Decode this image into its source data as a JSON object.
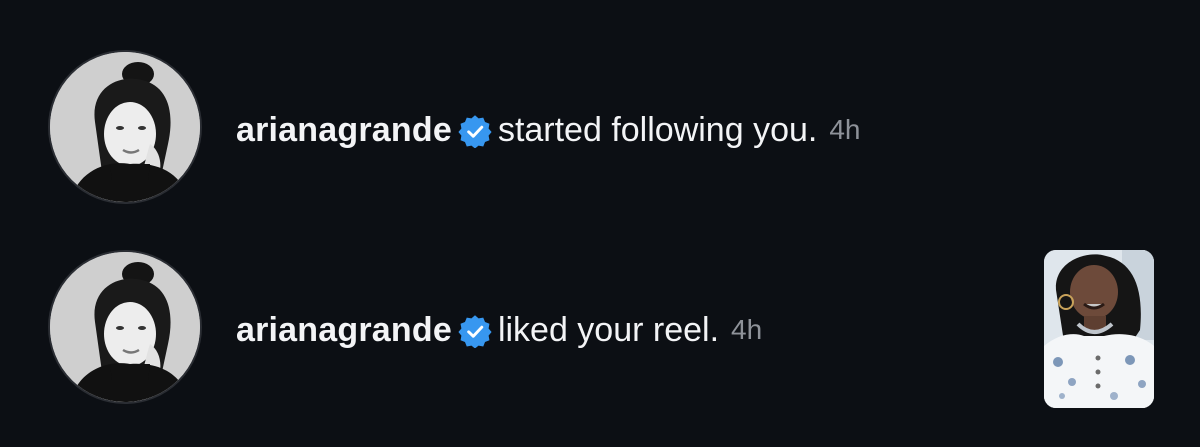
{
  "notifications": [
    {
      "username": "arianagrande",
      "verified_icon": "verified-badge-icon",
      "action": "started following you.",
      "time": "4h",
      "avatar": "profile-photo"
    },
    {
      "username": "arianagrande",
      "verified_icon": "verified-badge-icon",
      "action": "liked your reel.",
      "time": "4h",
      "avatar": "profile-photo",
      "thumbnail": "reel-thumbnail"
    }
  ],
  "colors": {
    "background": "#0c0f14",
    "text": "#f3f4f6",
    "timestamp": "#8e9299",
    "verified": "#3797f0"
  }
}
